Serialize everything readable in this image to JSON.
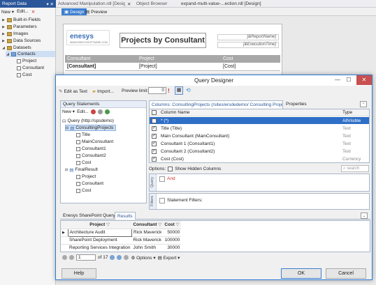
{
  "left_panel": {
    "title": "Report Data",
    "title_close": "▾ ✕",
    "toolbar": {
      "new_label": "New ▾",
      "edit_label": "Edit...",
      "x_label": "✕"
    },
    "items": [
      {
        "label": "Built-in Fields"
      },
      {
        "label": "Parameters"
      },
      {
        "label": "Images"
      },
      {
        "label": "Data Sources"
      },
      {
        "label": "Datasets"
      },
      {
        "label": "Contacts"
      },
      {
        "label": "Project"
      },
      {
        "label": "Consultant"
      },
      {
        "label": "Cost"
      }
    ]
  },
  "doc_tabs": [
    {
      "label": "Advanced Manipulation.rdl [Design]"
    },
    {
      "label": "✕"
    },
    {
      "label": "Object Browser"
    },
    {
      "label": "expand-multi-value-...ection.rdl [Design]"
    }
  ],
  "design_bar": {
    "design_label": "Design",
    "preview_label": "Preview"
  },
  "report": {
    "logo_text": "enesys",
    "logo_sub": "WWW.ENESYSSOFTWARE.COM",
    "title": "Projects by Consultant",
    "param1": "[&ReportName]",
    "param2": "[&ExecutionTime]",
    "headers": [
      "Consultant",
      "Project",
      "Cost"
    ],
    "row": [
      "[Consultant]",
      "[Project]",
      "[Cost]"
    ]
  },
  "dialog": {
    "title": "Query Designer",
    "minimize": "—",
    "maximize": "☐",
    "close": "✕",
    "toolbar": {
      "edit_as_text": "Edit as Text",
      "import": "Import...",
      "preview_limit_label": "Preview limit:",
      "preview_limit_value": "0"
    },
    "query_statements": {
      "header": "Query Statements",
      "new_label": "New ▾",
      "edit_label": "Edit...",
      "tree": [
        {
          "label": "Query (http://spsdemo)"
        },
        {
          "label": "ConsultingProjects"
        },
        {
          "label": "Title"
        },
        {
          "label": "MainConsultant"
        },
        {
          "label": "Consultant1"
        },
        {
          "label": "Consultant2"
        },
        {
          "label": "Cost"
        },
        {
          "label": "FinalResult"
        },
        {
          "label": "Project"
        },
        {
          "label": "Consultant"
        },
        {
          "label": "Cost"
        }
      ]
    },
    "columns_panel": {
      "tab_columns": "Columns: ConsultingProjects (/sites/ersdedemo/ Consulting Projects)",
      "tab_properties": "Properties",
      "col_header_name": "Column Name",
      "col_header_type": "Type",
      "rows": [
        {
          "name": "* (*)",
          "type": "AllVisible",
          "checked": false
        },
        {
          "name": "Title (Title)",
          "type": "Text",
          "checked": true
        },
        {
          "name": "Main Consultant (MainConsultant)",
          "type": "Text",
          "checked": true
        },
        {
          "name": "Consultant 1 (Consultant1)",
          "type": "Text",
          "checked": true
        },
        {
          "name": "Consultant 2 (Consultant2)",
          "type": "Text",
          "checked": true
        },
        {
          "name": "Cost (Cost)",
          "type": "Currency",
          "checked": true
        }
      ],
      "options_label": "Options:",
      "show_hidden_label": "Show Hidden Columns",
      "search_placeholder": "search",
      "query_label": "Query",
      "and_label": "And",
      "filters_label": "Filters",
      "statement_filters_label": "Statement Filters:"
    },
    "results": {
      "tab_sharepoint": "Enesys SharePoint Query",
      "tab_results": "Results",
      "headers": [
        "Project",
        "Consultant",
        "Cost"
      ],
      "rows": [
        {
          "project": "Architecture Audit",
          "consultant": "Rick Maverick",
          "cost": "50000"
        },
        {
          "project": "SharePoint Deployment",
          "consultant": "Rick Maverick",
          "cost": "100000"
        },
        {
          "project": "Reporting Services Integration",
          "consultant": "John Smith",
          "cost": "30000"
        }
      ],
      "pager_current": "1",
      "pager_total": "of 17",
      "options_label": "Options",
      "export_label": "Export"
    },
    "buttons": {
      "help": "Help",
      "ok": "OK",
      "cancel": "Cancel"
    }
  },
  "colors": {
    "accent": "#2b579a",
    "dialog_border": "#2b7bd6",
    "close_red": "#c75050",
    "and_red": "#d03030",
    "allvisible_blue": "#2e6fc7"
  }
}
